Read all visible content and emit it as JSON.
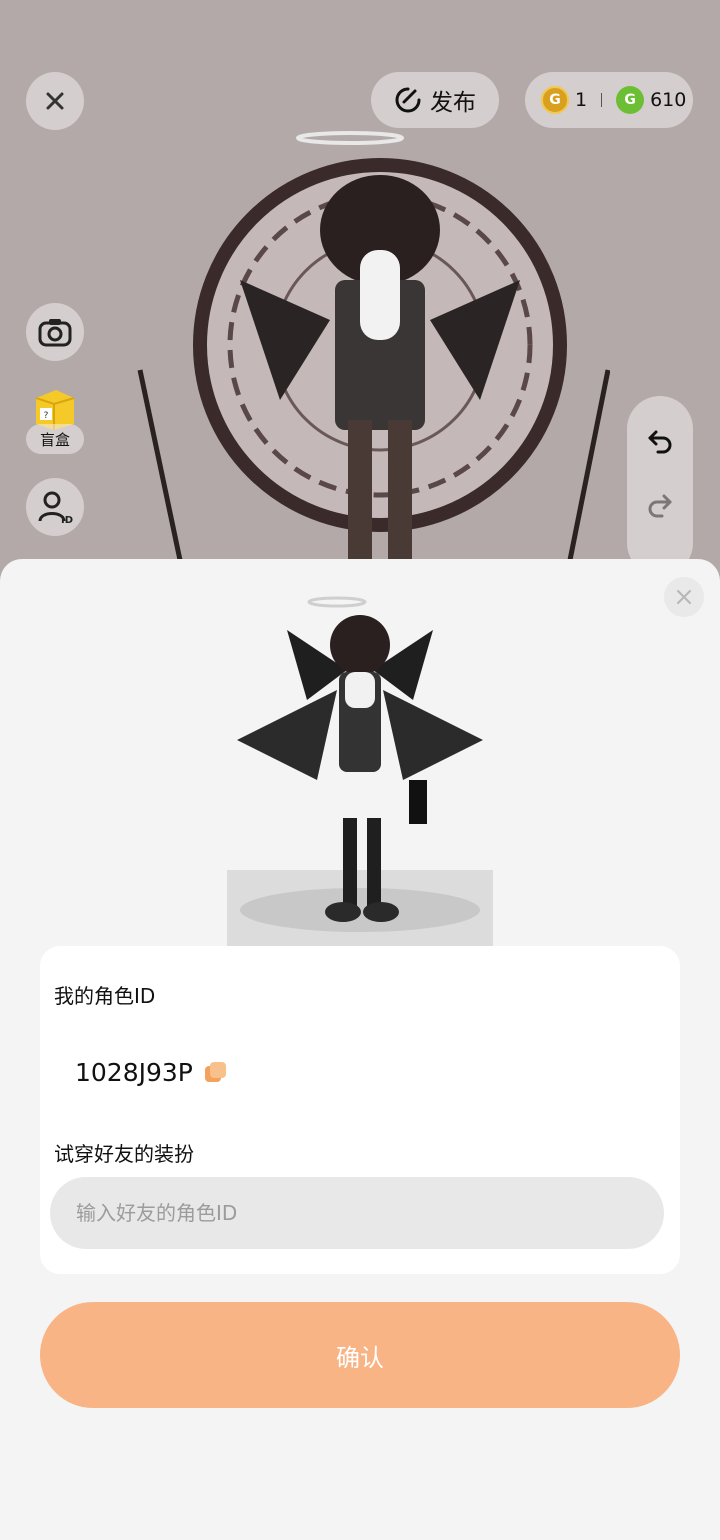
{
  "header": {
    "publish_label": "发布",
    "currency": {
      "gold_value": "1",
      "green_value": "610"
    }
  },
  "side_toolbar": {
    "blind_box_label": "盲盒"
  },
  "dialog": {
    "my_id_label": "我的角色ID",
    "my_id_value": "1028J93P",
    "try_on_label": "试穿好友的装扮",
    "friend_id_placeholder": "输入好友的角色ID",
    "confirm_label": "确认"
  },
  "colors": {
    "accent": "#f8b484",
    "scene_bg": "#b4a9a9",
    "gold_coin": "#d9a01f",
    "green_coin": "#6cbf35"
  }
}
